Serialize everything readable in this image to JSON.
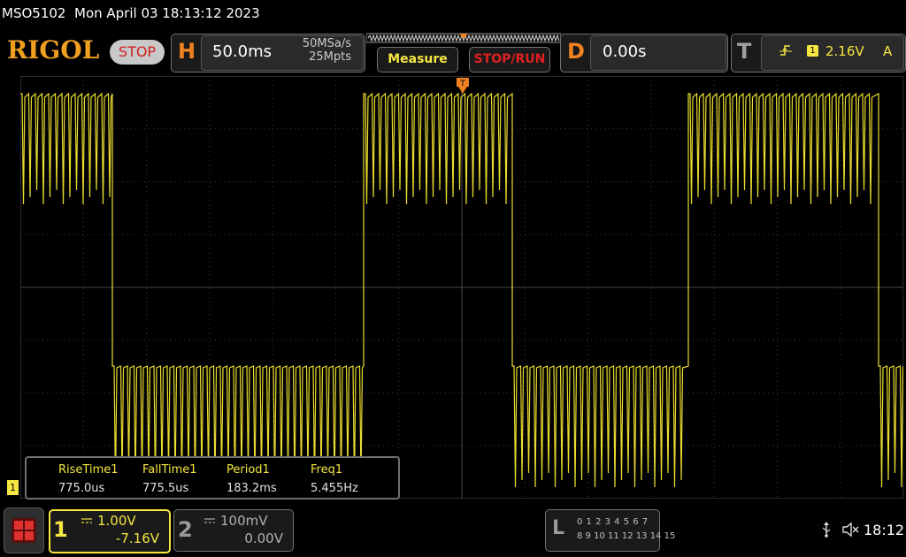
{
  "header": {
    "model": "MSO5102",
    "datetime": "Mon April 03 18:13:12 2023",
    "logo": "RIGOL",
    "run_state": "STOP"
  },
  "horizontal": {
    "letter": "H",
    "timebase": "50.0ms",
    "sample_rate": "50MSa/s",
    "memory_depth": "25Mpts"
  },
  "buttons": {
    "measure": "Measure",
    "stop_run": "STOP/RUN"
  },
  "delay": {
    "letter": "D",
    "value": "0.00s"
  },
  "trigger": {
    "letter": "T",
    "edge_icon": "rising-edge-icon",
    "source": "1",
    "level": "2.16V",
    "mode": "A"
  },
  "measurements": {
    "headers": [
      "RiseTime1",
      "FallTime1",
      "Period1",
      "Freq1"
    ],
    "values": [
      "775.0us",
      "775.5us",
      "183.2ms",
      "5.455Hz"
    ]
  },
  "channels": {
    "ch1": {
      "number": "1",
      "scale": "1.00V",
      "offset": "-7.16V",
      "marker": "1",
      "color": "#f5e642"
    },
    "ch2": {
      "number": "2",
      "scale": "100mV",
      "offset": "0.00V"
    }
  },
  "logic_analyzer": {
    "letter": "L",
    "row1": "0 1 2 3   4 5 6 7",
    "row2": "8 9 10 11 12 13 14 15"
  },
  "status": {
    "usb_icon": "usb-icon",
    "speaker_icon": "speaker-muted-icon",
    "time": "18:12"
  },
  "colors": {
    "accent_orange": "#f08020",
    "trace_yellow": "#f5e642",
    "stop_red": "#d02020"
  }
}
